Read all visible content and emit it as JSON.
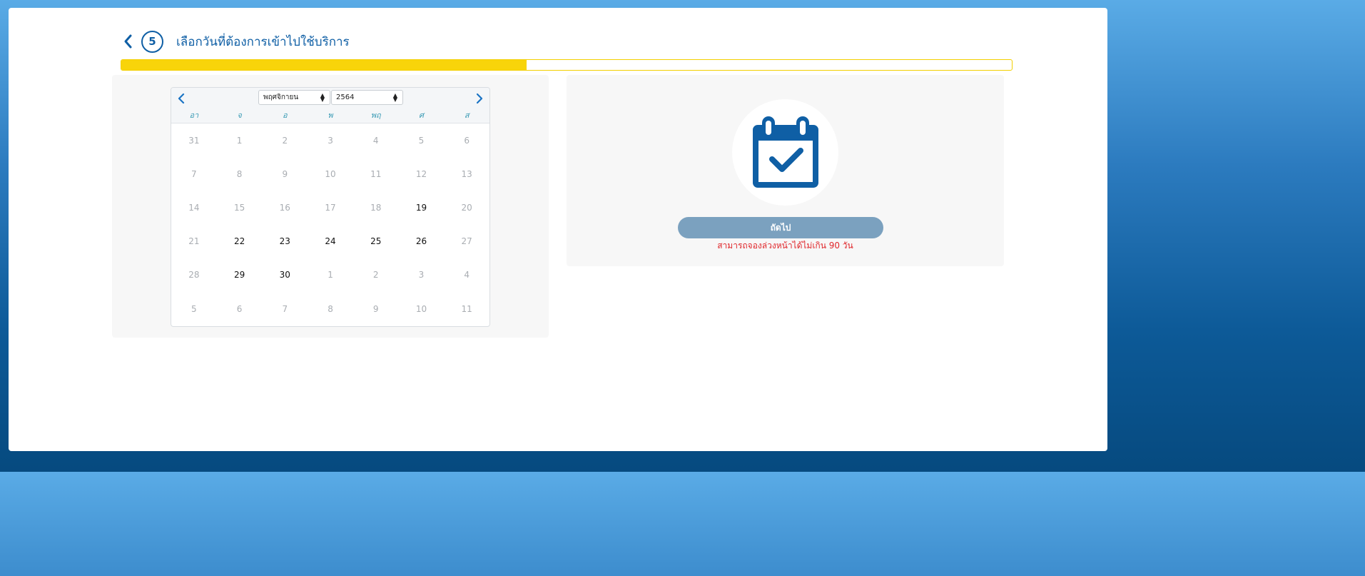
{
  "header": {
    "step_number": "5",
    "title": "เลือกวันที่ต้องการเข้าไปใช้บริการ"
  },
  "progress": {
    "fraction": 0.455,
    "fill_color": "#f8d40a"
  },
  "calendar": {
    "month_select": "พฤศจิกายน",
    "year_select": "2564",
    "weekdays": [
      "อา",
      "จ",
      "อ",
      "พ",
      "พฤ",
      "ศ",
      "ส"
    ],
    "weeks": [
      [
        {
          "d": "31",
          "a": false
        },
        {
          "d": "1",
          "a": false
        },
        {
          "d": "2",
          "a": false
        },
        {
          "d": "3",
          "a": false
        },
        {
          "d": "4",
          "a": false
        },
        {
          "d": "5",
          "a": false
        },
        {
          "d": "6",
          "a": false
        }
      ],
      [
        {
          "d": "7",
          "a": false
        },
        {
          "d": "8",
          "a": false
        },
        {
          "d": "9",
          "a": false
        },
        {
          "d": "10",
          "a": false
        },
        {
          "d": "11",
          "a": false
        },
        {
          "d": "12",
          "a": false
        },
        {
          "d": "13",
          "a": false
        }
      ],
      [
        {
          "d": "14",
          "a": false
        },
        {
          "d": "15",
          "a": false
        },
        {
          "d": "16",
          "a": false
        },
        {
          "d": "17",
          "a": false
        },
        {
          "d": "18",
          "a": false
        },
        {
          "d": "19",
          "a": true
        },
        {
          "d": "20",
          "a": false
        }
      ],
      [
        {
          "d": "21",
          "a": false
        },
        {
          "d": "22",
          "a": true
        },
        {
          "d": "23",
          "a": true
        },
        {
          "d": "24",
          "a": true
        },
        {
          "d": "25",
          "a": true
        },
        {
          "d": "26",
          "a": true
        },
        {
          "d": "27",
          "a": false
        }
      ],
      [
        {
          "d": "28",
          "a": false
        },
        {
          "d": "29",
          "a": true
        },
        {
          "d": "30",
          "a": true
        },
        {
          "d": "1",
          "a": false
        },
        {
          "d": "2",
          "a": false
        },
        {
          "d": "3",
          "a": false
        },
        {
          "d": "4",
          "a": false
        }
      ],
      [
        {
          "d": "5",
          "a": false
        },
        {
          "d": "6",
          "a": false
        },
        {
          "d": "7",
          "a": false
        },
        {
          "d": "8",
          "a": false
        },
        {
          "d": "9",
          "a": false
        },
        {
          "d": "10",
          "a": false
        },
        {
          "d": "11",
          "a": false
        }
      ]
    ]
  },
  "side": {
    "icon": "calendar-check-icon",
    "next_label": "ถัดไป",
    "notice": "สามารถจองล่วงหน้าได้ไม่เกิน 90 วัน"
  },
  "colors": {
    "primary": "#0f5fa5",
    "button": "#7ba1bf",
    "notice": "#e0262a"
  }
}
